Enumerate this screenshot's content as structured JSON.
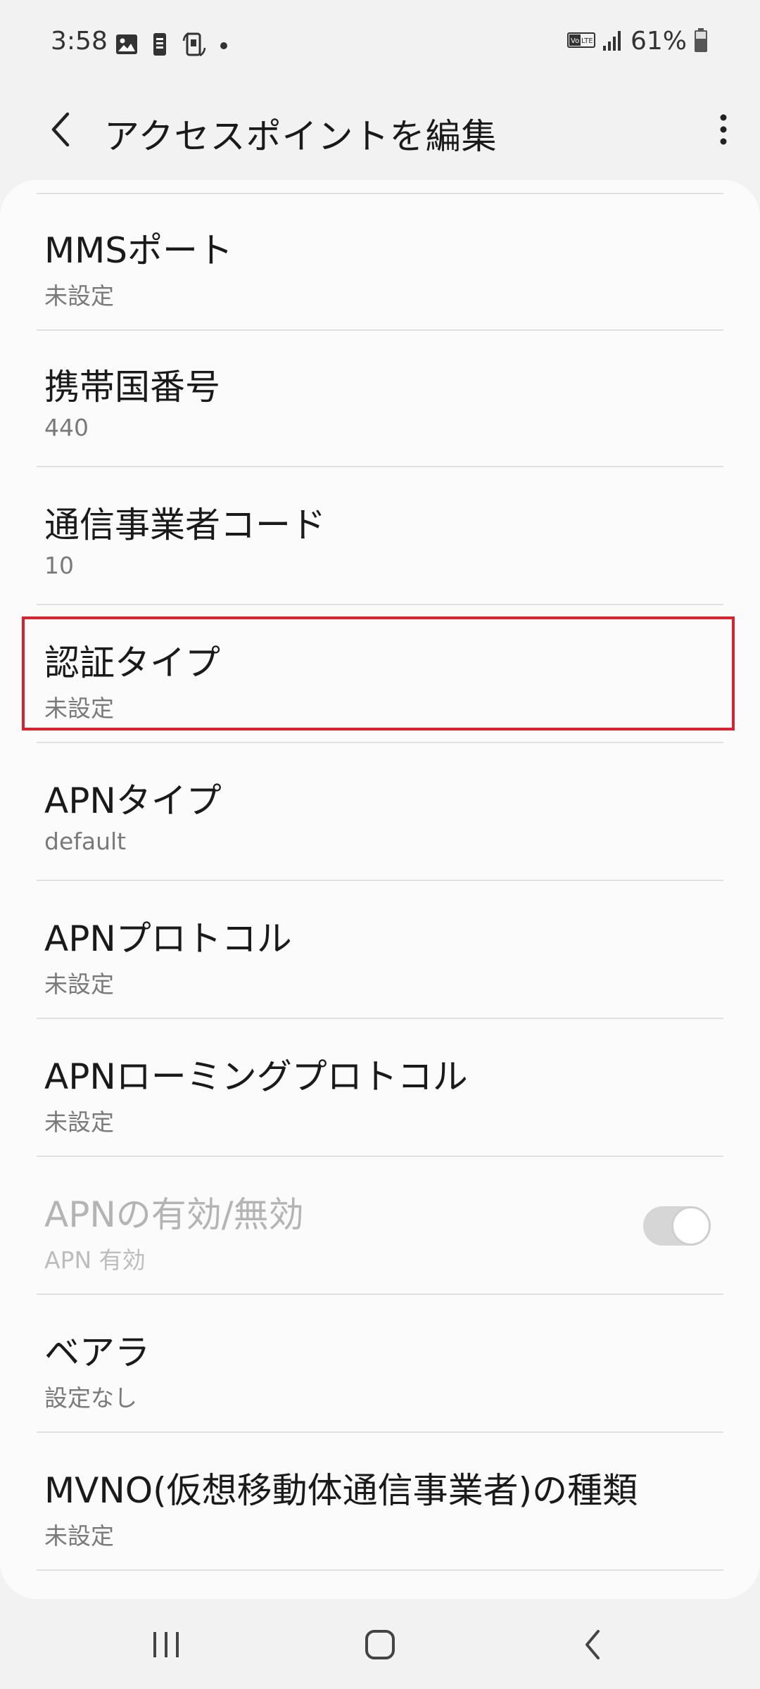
{
  "status_bar": {
    "time": "3:58",
    "battery_percent": "61%",
    "icons": [
      "image-icon",
      "notification-icon",
      "phone-rotate-icon",
      "dot-icon",
      "volte-icon",
      "signal-icon",
      "battery-icon"
    ]
  },
  "header": {
    "title": "アクセスポイントを編集",
    "back_icon": "back-chevron-icon",
    "more_icon": "more-vertical-icon"
  },
  "items": [
    {
      "title": "MMSポート",
      "value": "未設定"
    },
    {
      "title": "携帯国番号",
      "value": "440"
    },
    {
      "title": "通信事業者コード",
      "value": "10"
    },
    {
      "title": "認証タイプ",
      "value": "未設定",
      "highlighted": true
    },
    {
      "title": "APNタイプ",
      "value": "default"
    },
    {
      "title": "APNプロトコル",
      "value": "未設定"
    },
    {
      "title": "APNローミングプロトコル",
      "value": "未設定"
    },
    {
      "title": "APNの有効/無効",
      "value": "APN 有効",
      "disabled": true,
      "toggle_on": true
    },
    {
      "title": "ベアラ",
      "value": "設定なし"
    },
    {
      "title": "MVNO(仮想移動体通信事業者)の種類",
      "value": "未設定"
    }
  ],
  "colors": {
    "highlight": "#d8222e",
    "background": "#f2f2f2",
    "card": "#fbfbfb"
  },
  "nav_bar": {
    "icons": [
      "recent-apps-icon",
      "home-icon",
      "back-icon"
    ]
  }
}
